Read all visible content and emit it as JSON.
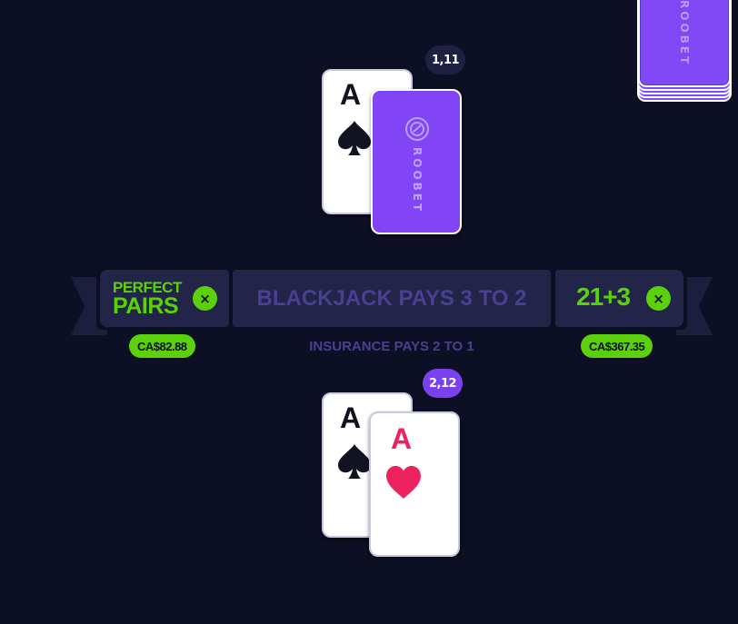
{
  "shoe": {
    "brand": "ROOBET"
  },
  "dealer": {
    "count": "1,11",
    "cards": [
      {
        "rank": "A",
        "suit": "spade-icon",
        "color": "#111222",
        "face_up": true
      },
      {
        "face_up": false,
        "brand": "ROOBET"
      }
    ]
  },
  "table": {
    "perfect_pairs": {
      "title_line1": "PERFECT",
      "title_line2": "PAIRS",
      "remove_symbol": "×",
      "bet": "CA$82.88"
    },
    "payout_text": "BLACKJACK PAYS 3 TO 2",
    "insurance_text": "INSURANCE PAYS 2 TO 1",
    "twenty_one_plus_three": {
      "title": "21+3",
      "remove_symbol": "×",
      "bet": "CA$367.35"
    },
    "accent_color": "#5bd10c"
  },
  "player": {
    "count": "2,12",
    "cards": [
      {
        "rank": "A",
        "suit": "spade-icon",
        "color": "#111222"
      },
      {
        "rank": "A",
        "suit": "heart-icon",
        "color": "#ef2260"
      }
    ]
  },
  "colors": {
    "background": "#0d0f24",
    "card_back": "#8145f6",
    "badge_player": "#7a41f0"
  }
}
